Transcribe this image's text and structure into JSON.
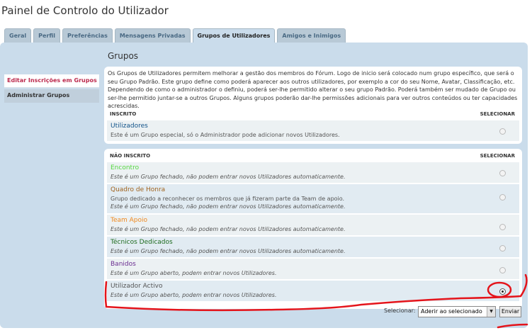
{
  "page": {
    "title": "Painel de Controlo do Utilizador"
  },
  "tabs": [
    {
      "label": "Geral"
    },
    {
      "label": "Perfil"
    },
    {
      "label": "Preferências"
    },
    {
      "label": "Mensagens Privadas"
    },
    {
      "label": "Grupos de Utilizadores",
      "active": true
    },
    {
      "label": "Amigos e Inimigos"
    }
  ],
  "sidebar": {
    "items": [
      {
        "label": "Editar Inscrições em Grupos",
        "active": true
      },
      {
        "label": "Administrar Grupos"
      }
    ]
  },
  "content": {
    "title": "Grupos",
    "description": "Os Grupos de Utilizadores permitem melhorar a gestão dos membros do Fórum. Logo de inicio será colocado num grupo específico, que será o seu Grupo Padrão. Este grupo define como poderá aparecer aos outros utilizadores, por exemplo a cor do seu Nome, Avatar, Classificação, etc. Dependendo de como o administrador o definiu, poderá ser-lhe permitido alterar o seu grupo Padrão. Poderá também ser mudado de Grupo ou ser-lhe permitido juntar-se a outros Grupos. Alguns grupos poderão dar-lhe permissões adicionais para ver outros conteúdos ou ter capacidades acrescidas.",
    "member": {
      "header_left": "INSCRITO",
      "header_right": "SELECIONAR",
      "groups": [
        {
          "name": "Utilizadores",
          "desc": "Este é um Grupo especial, só o Administrador pode adicionar novos Utilizadores.",
          "color": "#105289"
        }
      ]
    },
    "nonmember": {
      "header_left": "NÃO INSCRITO",
      "header_right": "SELECIONAR",
      "groups": [
        {
          "name": "Encontro",
          "desc": "Este é um Grupo fechado, não podem entrar novos Utilizadores automaticamente.",
          "color": "#55d840"
        },
        {
          "name": "Quadro de Honra",
          "desc": "Grupo dedicado a reconhecer os membros que já fizeram parte da Team de apoio.",
          "desc2": "Este é um Grupo fechado, não podem entrar novos Utilizadores automaticamente.",
          "color": "#a0631e"
        },
        {
          "name": "Team Apoio",
          "desc": "Este é um Grupo fechado, não podem entrar novos Utilizadores automaticamente.",
          "color": "#f08a20"
        },
        {
          "name": "Técnicos Dedicados",
          "desc": "Este é um Grupo fechado, não podem entrar novos Utilizadores automaticamente.",
          "color": "#1e6b1e"
        },
        {
          "name": "Banidos",
          "desc": "Este é um Grupo aberto, podem entrar novos Utilizadores.",
          "color": "#6a2d90"
        },
        {
          "name": "Utilizador Activo",
          "desc": "Este é um Grupo aberto, podem entrar novos Utilizadores.",
          "color": "#555555",
          "selected": true
        }
      ]
    }
  },
  "footer": {
    "select_label": "Selecionar:",
    "select_value": "Aderir ao selecionado",
    "submit_label": "Enviar"
  },
  "annotation_color": "#e4141b"
}
